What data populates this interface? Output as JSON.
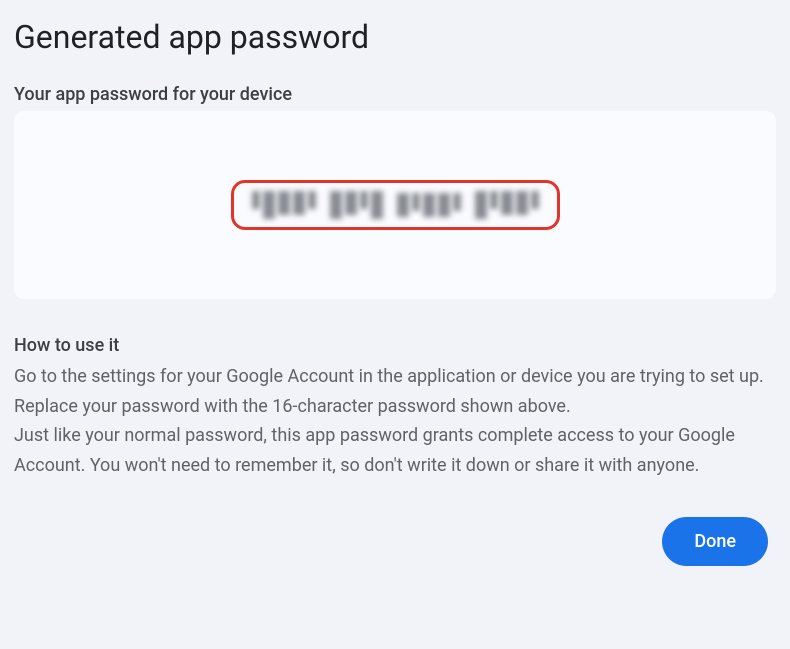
{
  "title": "Generated app password",
  "subtitle": "Your app password for your device",
  "password_display": "•••• •••• •••• ••••",
  "howto": {
    "heading": "How to use it",
    "para1": "Go to the settings for your Google Account in the application or device you are trying to set up. Replace your password with the 16-character password shown above.",
    "para2": "Just like your normal password, this app password grants complete access to your Google Account. You won't need to remember it, so don't write it down or share it with anyone."
  },
  "done_label": "Done",
  "colors": {
    "highlight_border": "#e3342a",
    "primary_button": "#1a73e8"
  }
}
